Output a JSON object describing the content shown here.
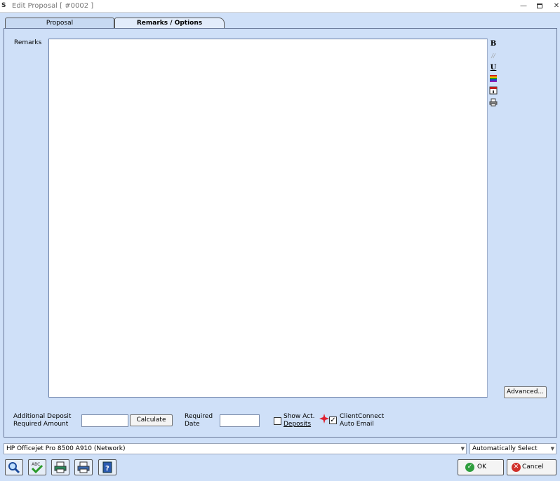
{
  "window": {
    "title": "Edit Proposal [ #0002 ]",
    "app_icon_text": "S"
  },
  "tabs": [
    {
      "label": "Proposal",
      "active": false
    },
    {
      "label": "Remarks / Options",
      "active": true
    }
  ],
  "remarks": {
    "label": "Remarks",
    "content": ""
  },
  "format_toolbar": {
    "bold": "B",
    "italic": "//",
    "underline": "U"
  },
  "advanced_button": "Advanced...",
  "deposit": {
    "label_line1": "Additional Deposit",
    "label_line2": "Required Amount",
    "value": "",
    "calculate_button": "Calculate"
  },
  "required_date": {
    "label_line1": "Required",
    "label_line2": "Date",
    "value": ""
  },
  "show_act_deposits": {
    "label_line1": "Show Act.",
    "label_line2": "Deposits",
    "checked": false
  },
  "client_connect": {
    "label_line1": "ClientConnect",
    "label_line2": "Auto Email",
    "checked": true,
    "check_glyph": "✓"
  },
  "printer": {
    "selected": "HP Officejet Pro 8500 A910 (Network)",
    "tray": "Automatically Select"
  },
  "bottom_buttons": {
    "ok": "OK",
    "cancel": "Cancel"
  },
  "colors": {
    "window_bg": "#cfe0f8",
    "ok_icon": "#2e9e3e",
    "cancel_icon": "#d0302a"
  }
}
